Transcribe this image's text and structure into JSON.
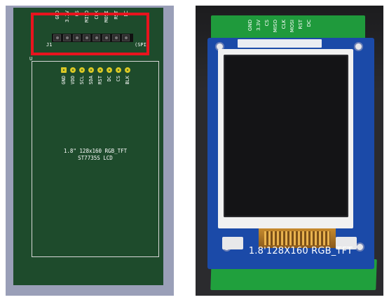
{
  "cad": {
    "connector_ref": "J1",
    "interface_label": "(SPI)",
    "footprint_ref": "U",
    "connector_pins": [
      "GND",
      "3.3V",
      "CS",
      "MISO",
      "CLK",
      "MOSI",
      "RST",
      "DC"
    ],
    "lcd_pins": [
      "GND",
      "VDD",
      "SCL",
      "SDA",
      "RST",
      "DC",
      "CS",
      "BLK"
    ],
    "title_line1": "1.8\" 128x160 RGB_TFT",
    "title_line2": "ST7735S LCD",
    "highlight_color": "#e8141e",
    "board_color": "#1e4b2c"
  },
  "photo": {
    "header_labels": [
      "GND",
      "3.3V",
      "CS",
      "MISO",
      "CLK",
      "MOSI",
      "RST",
      "DC"
    ],
    "bottom_label": "1.8'128X160 RGB_TFT",
    "board_color": "#1b4aa8",
    "carrier_color": "#1f9a3c"
  }
}
